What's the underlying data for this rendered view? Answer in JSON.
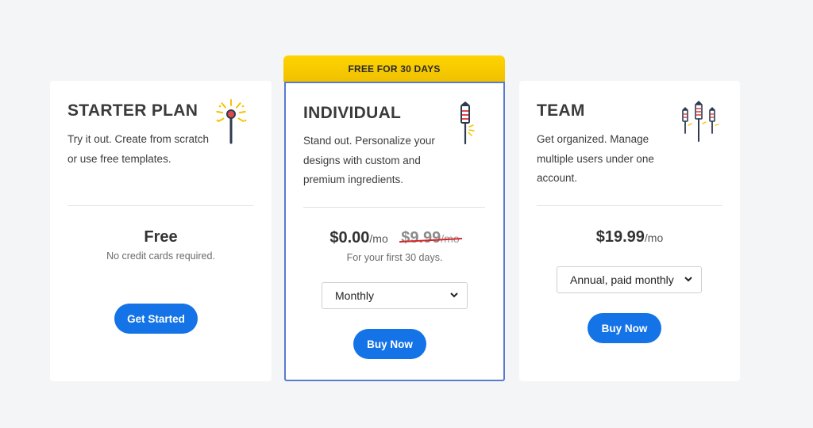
{
  "ribbon": {
    "label": "FREE FOR 30 DAYS"
  },
  "colors": {
    "accent": "#1473e6",
    "ribbon": "#ffd400",
    "highlight_border": "#5a79cf",
    "strike": "#d7262a"
  },
  "plans": {
    "starter": {
      "title": "STARTER PLAN",
      "description_lines": [
        "Try it out. Create from scratch",
        "or use free templates."
      ],
      "price": "Free",
      "note": "No credit cards required.",
      "button_label": "Get Started",
      "icon": "sparkler-icon"
    },
    "individual": {
      "title": "INDIVIDUAL",
      "description_lines": [
        "Stand out. Personalize your",
        "designs with custom and",
        "premium ingredients."
      ],
      "price": "$0.00",
      "price_unit": "/mo",
      "old_price": "$9.99",
      "old_price_unit": "/mo",
      "note": "For your first 30 days.",
      "billing_selected": "Monthly",
      "button_label": "Buy Now",
      "icon": "firework-rocket-icon"
    },
    "team": {
      "title": "TEAM",
      "description_lines": [
        "Get organized. Manage",
        "multiple users under one",
        "account."
      ],
      "price": "$19.99",
      "price_unit": "/mo",
      "billing_selected": "Annual, paid monthly",
      "button_label": "Buy Now",
      "icon": "firework-rockets-group-icon"
    }
  }
}
